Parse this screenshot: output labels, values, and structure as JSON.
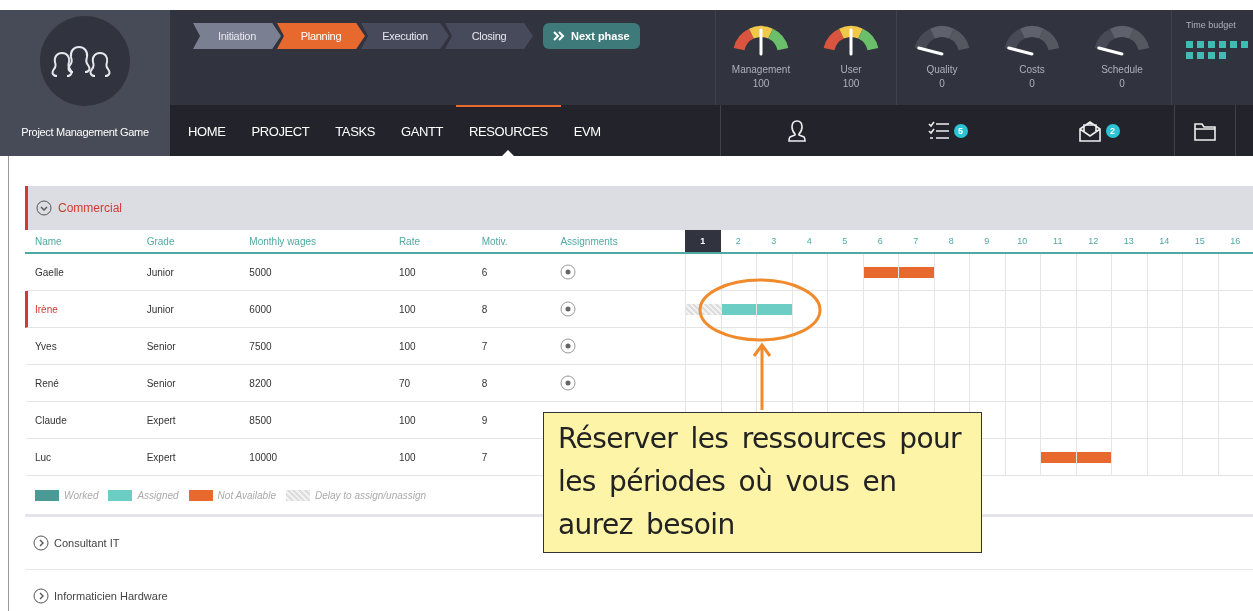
{
  "app": {
    "title": "Project Management Game"
  },
  "phases": [
    {
      "label": "Initiation",
      "selected": false
    },
    {
      "label": "Planning",
      "selected": true
    },
    {
      "label": "Execution",
      "selected": false
    },
    {
      "label": "Closing",
      "selected": false
    }
  ],
  "next_phase": {
    "label": "Next phase"
  },
  "gauges": [
    {
      "label": "Management",
      "value": "100",
      "active": true
    },
    {
      "label": "User",
      "value": "100",
      "active": true
    },
    {
      "label": "Quality",
      "value": "0",
      "active": false
    },
    {
      "label": "Costs",
      "value": "0",
      "active": false
    },
    {
      "label": "Schedule",
      "value": "0",
      "active": false
    }
  ],
  "time_budget": {
    "label": "Time budget",
    "blocks": [
      {
        "filled": true
      },
      {
        "filled": true
      },
      {
        "filled": true
      },
      {
        "filled": true
      },
      {
        "filled": true
      },
      {
        "filled": true
      },
      {
        "filled": true
      },
      {
        "filled": true
      },
      {
        "filled": true
      },
      {
        "filled": true
      }
    ]
  },
  "nav": [
    {
      "label": "HOME",
      "selected": false
    },
    {
      "label": "PROJECT",
      "selected": false
    },
    {
      "label": "TASKS",
      "selected": false
    },
    {
      "label": "GANTT",
      "selected": false
    },
    {
      "label": "RESOURCES",
      "selected": true
    },
    {
      "label": "EVM",
      "selected": false
    }
  ],
  "toolbar": [
    {
      "kind": "person"
    },
    {
      "kind": "checklist",
      "badge": "5"
    },
    {
      "kind": "mail",
      "badge": "2"
    },
    {
      "kind": "folder"
    }
  ],
  "section": {
    "title": "Commercial",
    "expanded": true,
    "columns": [
      "Name",
      "Grade",
      "Monthly wages",
      "Rate",
      "Motiv.",
      "Assignments"
    ],
    "days": [
      {
        "label": "1",
        "selected": true
      },
      {
        "label": "2",
        "selected": false
      },
      {
        "label": "3",
        "selected": false
      },
      {
        "label": "4",
        "selected": false
      },
      {
        "label": "5",
        "selected": false
      },
      {
        "label": "6",
        "selected": false
      },
      {
        "label": "7",
        "selected": false
      },
      {
        "label": "8",
        "selected": false
      },
      {
        "label": "9",
        "selected": false
      },
      {
        "label": "10",
        "selected": false
      },
      {
        "label": "11",
        "selected": false
      },
      {
        "label": "12",
        "selected": false
      },
      {
        "label": "13",
        "selected": false
      },
      {
        "label": "14",
        "selected": false
      },
      {
        "label": "15",
        "selected": false
      },
      {
        "label": "16",
        "selected": false
      }
    ],
    "rows": [
      {
        "name": "Gaelle",
        "grade": "Junior",
        "wages": "5000",
        "rate": "100",
        "motiv": "6",
        "selected": false,
        "assignment_action": {
          "kind": "add"
        },
        "schedule": [
          {
            "kind": "free"
          },
          {
            "kind": "free"
          },
          {
            "kind": "free"
          },
          {
            "kind": "free"
          },
          {
            "kind": "free"
          },
          {
            "kind": "not_available"
          },
          {
            "kind": "not_available"
          },
          {
            "kind": "free"
          },
          {
            "kind": "free"
          },
          {
            "kind": "free"
          },
          {
            "kind": "free"
          },
          {
            "kind": "free"
          },
          {
            "kind": "free"
          },
          {
            "kind": "free"
          },
          {
            "kind": "free"
          },
          {
            "kind": "free"
          }
        ]
      },
      {
        "name": "Irène",
        "grade": "Junior",
        "wages": "6000",
        "rate": "100",
        "motiv": "8",
        "selected": true,
        "assignment_action": {
          "kind": "add"
        },
        "schedule": [
          {
            "kind": "delay"
          },
          {
            "kind": "assigned"
          },
          {
            "kind": "assigned"
          },
          {
            "kind": "free"
          },
          {
            "kind": "free"
          },
          {
            "kind": "free"
          },
          {
            "kind": "free"
          },
          {
            "kind": "free"
          },
          {
            "kind": "free"
          },
          {
            "kind": "free"
          },
          {
            "kind": "free"
          },
          {
            "kind": "free"
          },
          {
            "kind": "free"
          },
          {
            "kind": "free"
          },
          {
            "kind": "free"
          },
          {
            "kind": "free"
          }
        ]
      },
      {
        "name": "Yves",
        "grade": "Senior",
        "wages": "7500",
        "rate": "100",
        "motiv": "7",
        "selected": false,
        "assignment_action": {
          "kind": "add"
        },
        "schedule": [
          {
            "kind": "free"
          },
          {
            "kind": "free"
          },
          {
            "kind": "free"
          },
          {
            "kind": "free"
          },
          {
            "kind": "free"
          },
          {
            "kind": "free"
          },
          {
            "kind": "free"
          },
          {
            "kind": "free"
          },
          {
            "kind": "free"
          },
          {
            "kind": "free"
          },
          {
            "kind": "free"
          },
          {
            "kind": "free"
          },
          {
            "kind": "free"
          },
          {
            "kind": "free"
          },
          {
            "kind": "free"
          },
          {
            "kind": "free"
          }
        ]
      },
      {
        "name": "René",
        "grade": "Senior",
        "wages": "8200",
        "rate": "70",
        "motiv": "8",
        "selected": false,
        "assignment_action": {
          "kind": "add"
        },
        "schedule": [
          {
            "kind": "free"
          },
          {
            "kind": "free"
          },
          {
            "kind": "free"
          },
          {
            "kind": "free"
          },
          {
            "kind": "free"
          },
          {
            "kind": "free"
          },
          {
            "kind": "free"
          },
          {
            "kind": "free"
          },
          {
            "kind": "free"
          },
          {
            "kind": "free"
          },
          {
            "kind": "free"
          },
          {
            "kind": "free"
          },
          {
            "kind": "free"
          },
          {
            "kind": "free"
          },
          {
            "kind": "free"
          },
          {
            "kind": "free"
          }
        ]
      },
      {
        "name": "Claude",
        "grade": "Expert",
        "wages": "8500",
        "rate": "100",
        "motiv": "9",
        "selected": false,
        "schedule": [
          {
            "kind": "free"
          },
          {
            "kind": "free"
          },
          {
            "kind": "free"
          },
          {
            "kind": "free"
          },
          {
            "kind": "free"
          },
          {
            "kind": "free"
          },
          {
            "kind": "free"
          },
          {
            "kind": "free"
          },
          {
            "kind": "free"
          },
          {
            "kind": "free"
          },
          {
            "kind": "free"
          },
          {
            "kind": "free"
          },
          {
            "kind": "free"
          },
          {
            "kind": "free"
          },
          {
            "kind": "free"
          },
          {
            "kind": "free"
          }
        ]
      },
      {
        "name": "Luc",
        "grade": "Expert",
        "wages": "10000",
        "rate": "100",
        "motiv": "7",
        "selected": false,
        "schedule": [
          {
            "kind": "free"
          },
          {
            "kind": "free"
          },
          {
            "kind": "free"
          },
          {
            "kind": "free"
          },
          {
            "kind": "free"
          },
          {
            "kind": "free"
          },
          {
            "kind": "free"
          },
          {
            "kind": "free"
          },
          {
            "kind": "free"
          },
          {
            "kind": "free"
          },
          {
            "kind": "not_available"
          },
          {
            "kind": "not_available"
          },
          {
            "kind": "free"
          },
          {
            "kind": "free"
          },
          {
            "kind": "free"
          },
          {
            "kind": "free"
          }
        ]
      }
    ],
    "legend": [
      {
        "kind": "worked",
        "label": "Worked"
      },
      {
        "kind": "assigned",
        "label": "Assigned"
      },
      {
        "kind": "not_available",
        "label": "Not Available"
      },
      {
        "kind": "delay",
        "label": "Delay to assign/unassign"
      }
    ]
  },
  "other_sections": [
    {
      "title": "Consultant IT",
      "expanded": false
    },
    {
      "title": "Informaticien Hardware",
      "expanded": false
    }
  ],
  "callout": {
    "text": "Réserver les ressources pour les périodes où vous en aurez besoin"
  }
}
